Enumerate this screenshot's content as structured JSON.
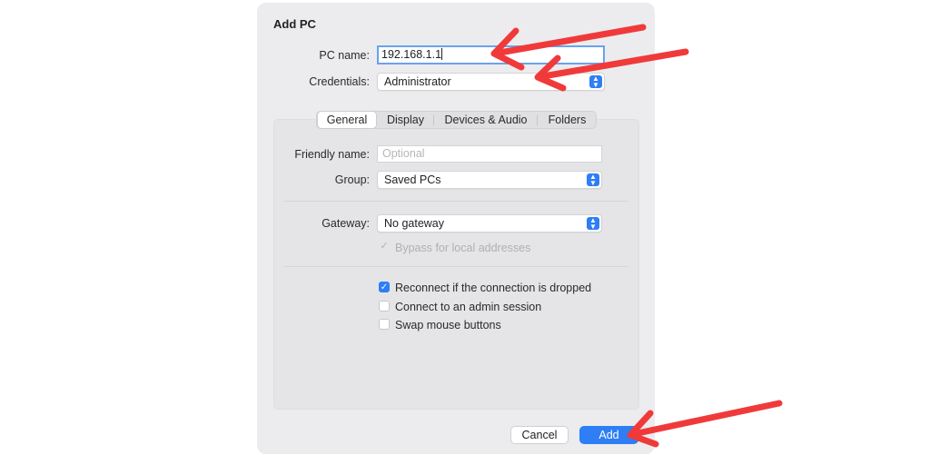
{
  "dialog": {
    "title": "Add PC",
    "pc_name": {
      "label": "PC name:",
      "value": "192.168.1.1"
    },
    "credentials": {
      "label": "Credentials:",
      "value": "Administrator"
    },
    "tabs": [
      {
        "label": "General",
        "active": true
      },
      {
        "label": "Display",
        "active": false
      },
      {
        "label": "Devices & Audio",
        "active": false
      },
      {
        "label": "Folders",
        "active": false
      }
    ],
    "general": {
      "friendly_name": {
        "label": "Friendly name:",
        "placeholder": "Optional"
      },
      "group": {
        "label": "Group:",
        "value": "Saved PCs"
      },
      "gateway": {
        "label": "Gateway:",
        "value": "No gateway"
      },
      "bypass_local": {
        "label": "Bypass for local addresses",
        "checked": true,
        "disabled": true
      },
      "reconnect": {
        "label": "Reconnect if the connection is dropped",
        "checked": true
      },
      "admin_session": {
        "label": "Connect to an admin session",
        "checked": false
      },
      "swap_mouse": {
        "label": "Swap mouse buttons",
        "checked": false
      }
    },
    "buttons": {
      "cancel": "Cancel",
      "add": "Add"
    }
  },
  "colors": {
    "accent": "#2e7ef6",
    "annotation_arrow": "#f03a3a",
    "dialog_bg": "#ececee"
  },
  "icons": {
    "popup": "up-down-chevron-icon",
    "check": "checkmark-icon"
  }
}
